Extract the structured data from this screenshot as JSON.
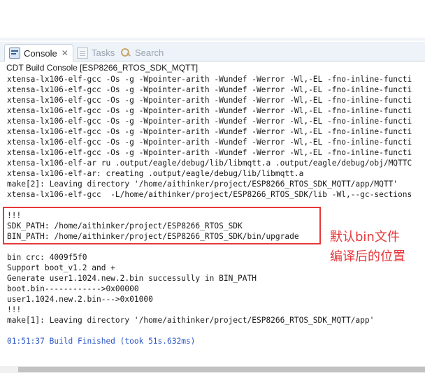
{
  "tabs": [
    {
      "label": "Console",
      "close": "✕"
    },
    {
      "label": "Tasks"
    },
    {
      "label": "Search"
    }
  ],
  "console_title": "CDT Build Console [ESP8266_RTOS_SDK_MQTT]",
  "lines": [
    "xtensa-lx106-elf-gcc -Os -g -Wpointer-arith -Wundef -Werror -Wl,-EL -fno-inline-functi",
    "xtensa-lx106-elf-gcc -Os -g -Wpointer-arith -Wundef -Werror -Wl,-EL -fno-inline-functi",
    "xtensa-lx106-elf-gcc -Os -g -Wpointer-arith -Wundef -Werror -Wl,-EL -fno-inline-functi",
    "xtensa-lx106-elf-gcc -Os -g -Wpointer-arith -Wundef -Werror -Wl,-EL -fno-inline-functi",
    "xtensa-lx106-elf-gcc -Os -g -Wpointer-arith -Wundef -Werror -Wl,-EL -fno-inline-functi",
    "xtensa-lx106-elf-gcc -Os -g -Wpointer-arith -Wundef -Werror -Wl,-EL -fno-inline-functi",
    "xtensa-lx106-elf-gcc -Os -g -Wpointer-arith -Wundef -Werror -Wl,-EL -fno-inline-functi",
    "xtensa-lx106-elf-gcc -Os -g -Wpointer-arith -Wundef -Werror -Wl,-EL -fno-inline-functi",
    "xtensa-lx106-elf-ar ru .output/eagle/debug/lib/libmqtt.a .output/eagle/debug/obj/MQTTC",
    "xtensa-lx106-elf-ar: creating .output/eagle/debug/lib/libmqtt.a",
    "make[2]: Leaving directory '/home/aithinker/project/ESP8266_RTOS_SDK_MQTT/app/MQTT'",
    "xtensa-lx106-elf-gcc  -L/home/aithinker/project/ESP8266_RTOS_SDK/lib -Wl,--gc-sections",
    "",
    "!!!",
    "SDK_PATH: /home/aithinker/project/ESP8266_RTOS_SDK",
    "BIN_PATH: /home/aithinker/project/ESP8266_RTOS_SDK/bin/upgrade",
    "",
    "bin crc: 4009f5f0",
    "Support boot_v1.2 and +",
    "Generate user1.1024.new.2.bin successully in BIN_PATH",
    "boot.bin------------>0x00000",
    "user1.1024.new.2.bin--->0x01000",
    "!!!",
    "make[1]: Leaving directory '/home/aithinker/project/ESP8266_RTOS_SDK_MQTT/app'",
    "",
    "01:51:37 Build Finished (took 51s.632ms)"
  ],
  "annotation": {
    "line1": "默认bin文件",
    "line2": "编译后的位置"
  },
  "colors": {
    "annotation": "#e5373a",
    "build_finished": "#2b55c7"
  }
}
